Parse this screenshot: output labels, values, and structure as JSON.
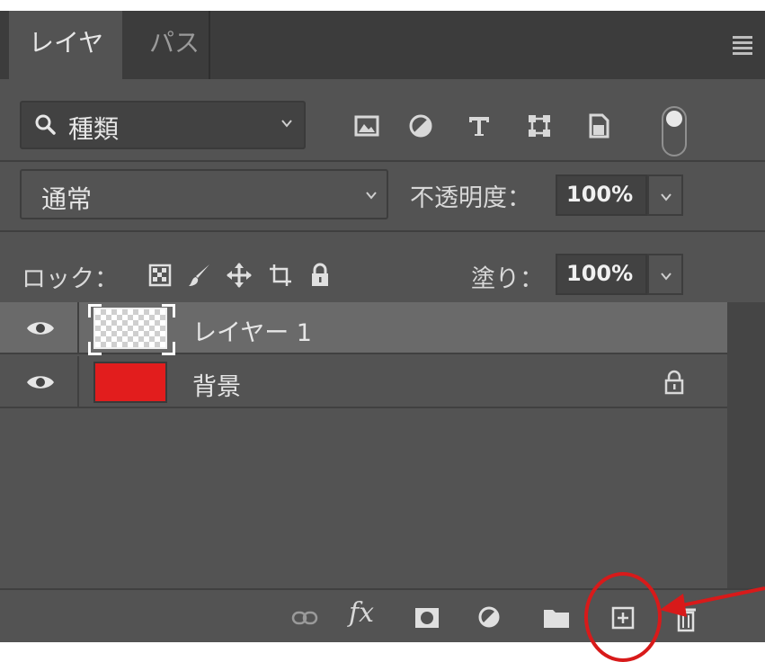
{
  "tabs": [
    {
      "label": "レイヤー",
      "active": true
    },
    {
      "label": "パス",
      "active": false
    }
  ],
  "filter": {
    "kind_label": "種類"
  },
  "filter_icons": [
    "image-filter-icon",
    "adjustment-filter-icon",
    "text-filter-icon",
    "shape-filter-icon",
    "smart-object-filter-icon"
  ],
  "blend": {
    "mode": "通常",
    "opacity_label": "不透明度：",
    "opacity_value": "100%"
  },
  "lock": {
    "label": "ロック：",
    "icons": [
      "lock-transparent-pixels-icon",
      "lock-image-pixels-icon",
      "lock-position-icon",
      "lock-artboard-icon",
      "lock-all-icon"
    ],
    "fill_label": "塗り：",
    "fill_value": "100%"
  },
  "layers": [
    {
      "name": "レイヤー 1",
      "visible": true,
      "selected": true,
      "thumbnail": "transparent",
      "locked": false
    },
    {
      "name": "背景",
      "visible": true,
      "selected": false,
      "thumbnail": "#e21d1d",
      "locked": true
    }
  ],
  "bottom_icons": [
    "link-layers-icon",
    "fx-icon",
    "add-mask-icon",
    "adjustment-layer-icon",
    "new-group-icon",
    "new-layer-icon",
    "trash-icon"
  ],
  "bottom": {
    "fx_label": "fx"
  },
  "colors": {
    "panel": "#535353",
    "tabbar": "#3c3c3c",
    "selected_row": "#6a6a6a",
    "annotation": "#d81a1a",
    "background_thumb": "#e21d1d"
  }
}
